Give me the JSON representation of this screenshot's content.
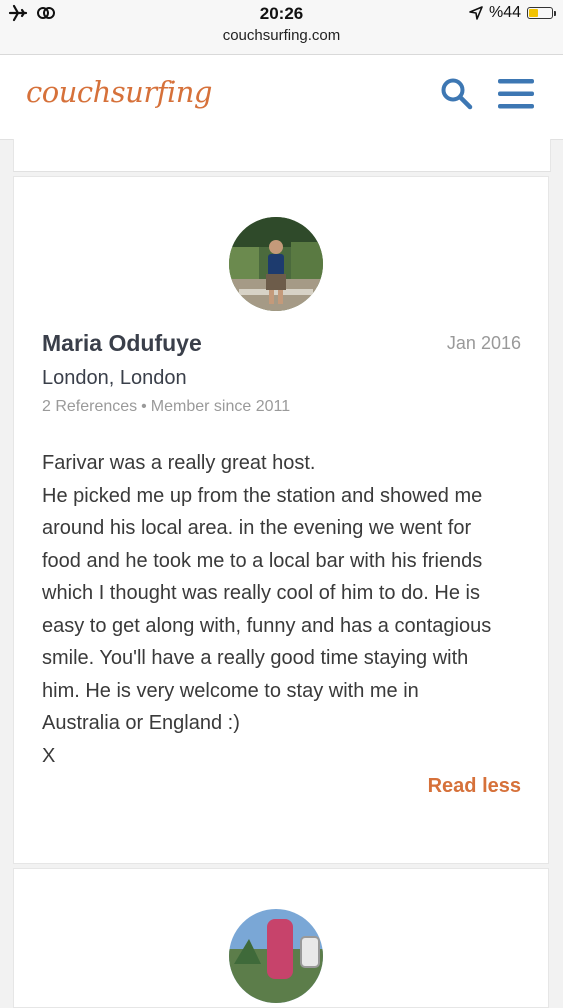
{
  "status_bar": {
    "time": "20:26",
    "url": "couchsurfing.com",
    "battery": "%44",
    "battery_level": 0.44
  },
  "header": {
    "logo": "couchsurfing",
    "brand_color": "#d6713a",
    "icon_color": "#3d77b3"
  },
  "reference": {
    "name": "Maria Odufuye",
    "date": "Jan 2016",
    "location": "London, London",
    "references": "2 References",
    "member_since": "Member since 2011",
    "body_lines": [
      "Farivar was a really great host.",
      "He picked me up from the station and showed me",
      "around his local area. in the evening we went for",
      "food and he took me to a local bar with his friends",
      "which I thought was really cool of him to do. He is",
      "easy to get along with, funny and has a contagious",
      "smile. You'll have a really good time staying with",
      "him. He is very welcome to stay with me in",
      "Australia or England :)",
      "X"
    ],
    "read_less": "Read less"
  }
}
